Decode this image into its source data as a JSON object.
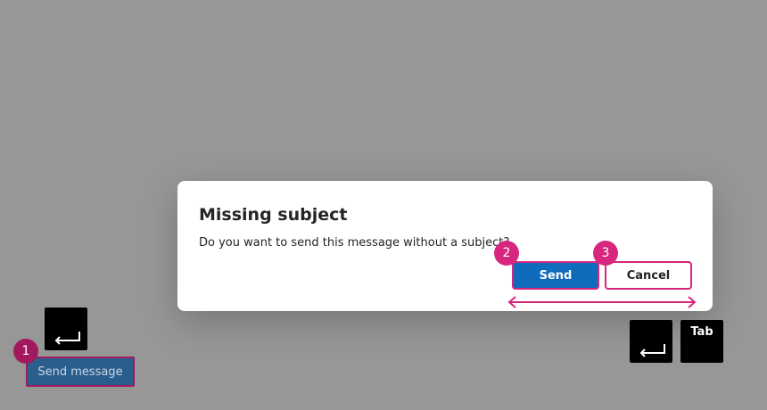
{
  "dialog": {
    "title": "Missing subject",
    "message": "Do you want to send this message without a subject?",
    "send_label": "Send",
    "cancel_label": "Cancel"
  },
  "background": {
    "send_message_label": "Send message"
  },
  "steps": [
    "1",
    "2",
    "3"
  ],
  "keys": {
    "tab_label": "Tab"
  },
  "colors": {
    "overlay": "#979797",
    "dialog_bg": "#ffffff",
    "primary_button": "#0f6cbd",
    "highlight": "#d7267e",
    "highlight_dark": "#a2195f",
    "key_bg": "#000000"
  },
  "icons": [
    "enter-key-icon",
    "tab-key-icon",
    "double-arrow-icon"
  ]
}
